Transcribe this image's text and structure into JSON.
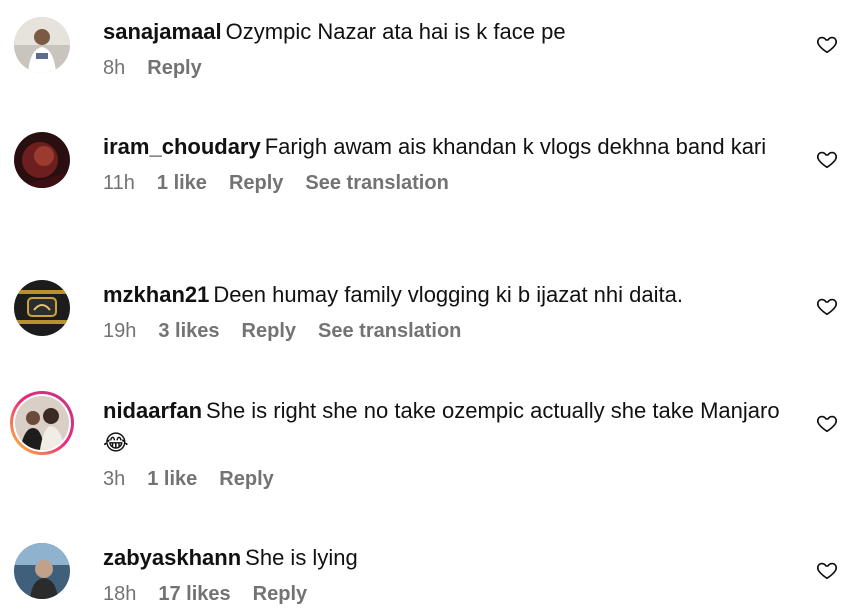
{
  "comments": [
    {
      "username": "sanajamaal",
      "text": "Ozympic Nazar ata hai is k face pe",
      "time": "8h",
      "likes": "",
      "reply": "Reply",
      "translation": ""
    },
    {
      "username": "iram_choudary",
      "text": "Farigh awam ais khandan k vlogs dekhna band kari",
      "time": "11h",
      "likes": "1 like",
      "reply": "Reply",
      "translation": "See translation"
    },
    {
      "username": "mzkhan21",
      "text": "Deen humay family vlogging ki b ijazat nhi daita.",
      "time": "19h",
      "likes": "3 likes",
      "reply": "Reply",
      "translation": "See translation"
    },
    {
      "username": "nidaarfan",
      "text": "She is right she no take ozempic actually she take Manjaro",
      "emoji": "😂",
      "time": "3h",
      "likes": "1 like",
      "reply": "Reply",
      "translation": ""
    },
    {
      "username": "zabyaskhann",
      "text": "She is lying",
      "time": "18h",
      "likes": "17 likes",
      "reply": "Reply",
      "translation": ""
    }
  ],
  "icons": {
    "like": "heart-outline-icon"
  },
  "colors": {
    "meta": "#737373",
    "text": "#111111",
    "story_ring_start": "#f9ce34",
    "story_ring_end": "#c13584"
  }
}
